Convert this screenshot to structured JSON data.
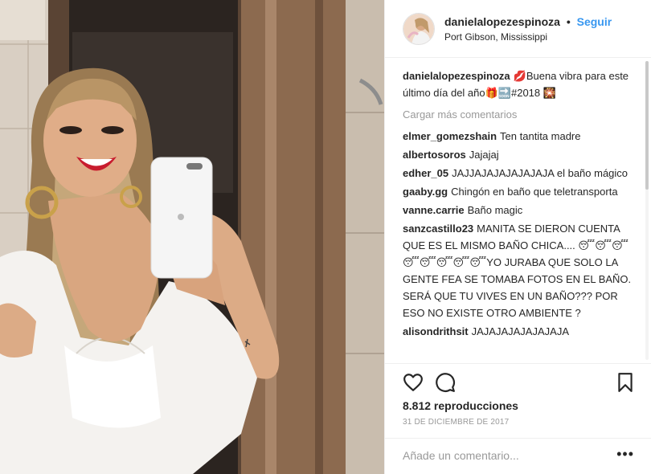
{
  "post": {
    "username": "danielalopezespinoza",
    "separator": "•",
    "follow_label": "Seguir",
    "location": "Port Gibson, Mississippi",
    "caption": {
      "username": "danielalopezespinoza",
      "text": "💋Buena vibra para este último día del año🎁🔜#2018 🎇"
    },
    "load_more_label": "Cargar más comentarios",
    "comments": [
      {
        "user": "elmer_gomezshain",
        "text": "Ten tantita madre"
      },
      {
        "user": "albertosoros",
        "text": "Jajajaj"
      },
      {
        "user": "edher_05",
        "text": "JAJJAJAJAJAJAJAJA el baño mágico"
      },
      {
        "user": "gaaby.gg",
        "text": "Chingón en baño que teletransporta"
      },
      {
        "user": "vanne.carrie",
        "text": "Baño magic"
      },
      {
        "user": "sanzcastillo23",
        "text": "MANITA SE DIERON CUENTA QUE ES EL MISMO BAÑO CHICA.... 😴😴😴😴😴😴😴😴YO JURABA QUE SOLO LA GENTE FEA SE TOMABA FOTOS EN EL BAÑO. SERÁ QUE TU VIVES EN UN BAÑO??? POR ESO NO EXISTE OTRO AMBIENTE ?"
      },
      {
        "user": "alisondrithsit",
        "text": "JAJAJAJAJAJAJAJA"
      }
    ],
    "views": "8.812 reproducciones",
    "date": "31 DE DICIEMBRE DE 2017",
    "comment_placeholder": "Añade un comentario...",
    "more_label": "•••"
  },
  "icons": {
    "like": "heart-icon",
    "comment": "comment-bubble-icon",
    "save": "bookmark-icon",
    "more": "more-options-icon"
  },
  "colors": {
    "link_blue": "#3897f0",
    "muted_gray": "#999999",
    "text_dark": "#262626"
  }
}
